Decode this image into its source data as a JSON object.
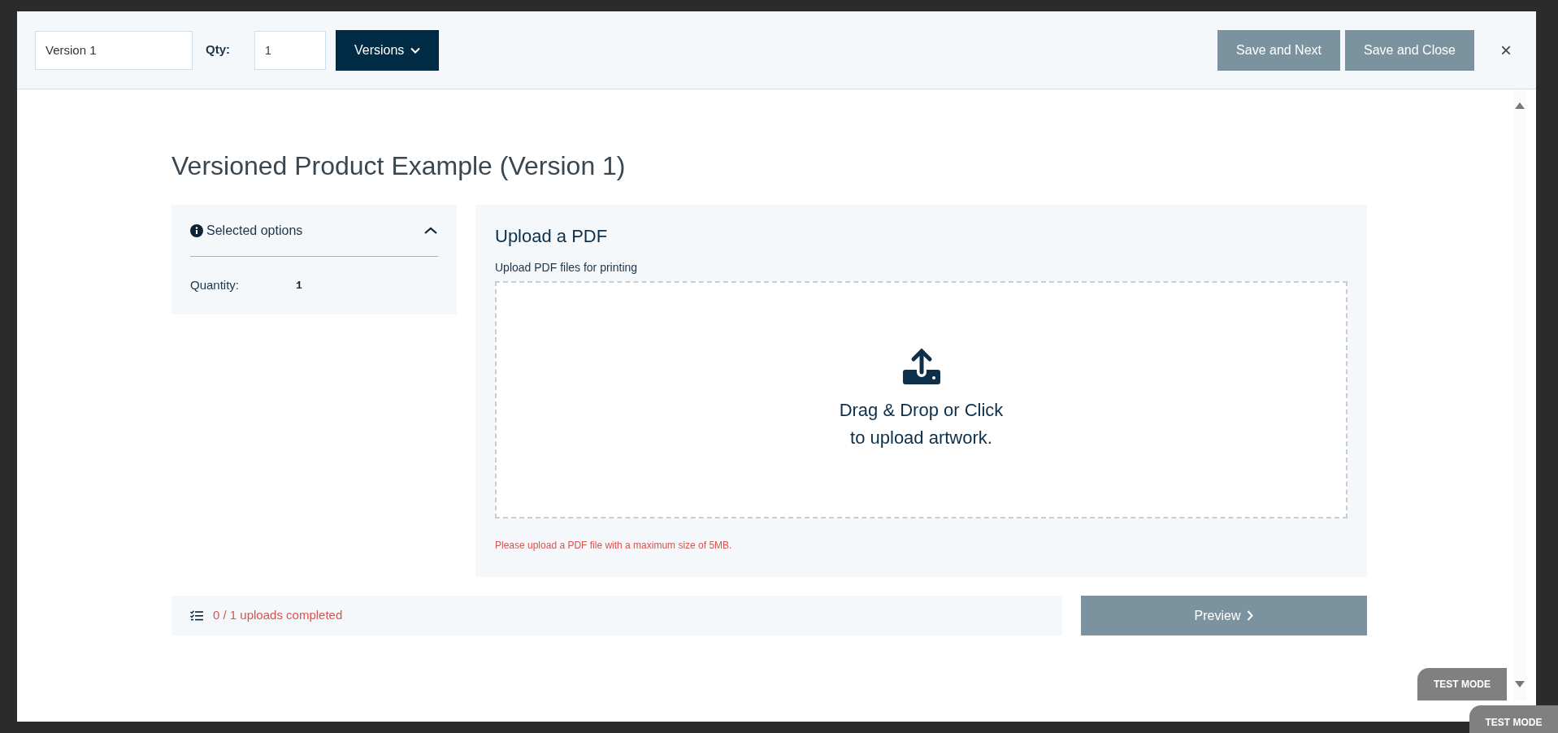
{
  "header": {
    "version_name": {
      "value": "Version 1"
    },
    "qty_label": "Qty:",
    "qty": {
      "value": "1"
    },
    "versions_button": "Versions",
    "buttons": [
      "Save and Next",
      "Save and Close"
    ],
    "close": "×"
  },
  "title": "Versioned Product Example (Version 1)",
  "selected_options": {
    "title": "Selected options",
    "expanded": true,
    "rows": [
      {
        "label": "Quantity:",
        "value": "1"
      }
    ]
  },
  "upload": {
    "title": "Upload a PDF",
    "subtitle": "Upload PDF files for printing",
    "drop_text": [
      "Drag & Drop or Click",
      "to upload artwork."
    ],
    "note": "Please upload a PDF file with a maximum size of 5MB."
  },
  "progress": {
    "text": "0 / 1 uploads completed"
  },
  "preview_button": "Preview",
  "badges": [
    "TEST MODE",
    "TEST MODE"
  ]
}
